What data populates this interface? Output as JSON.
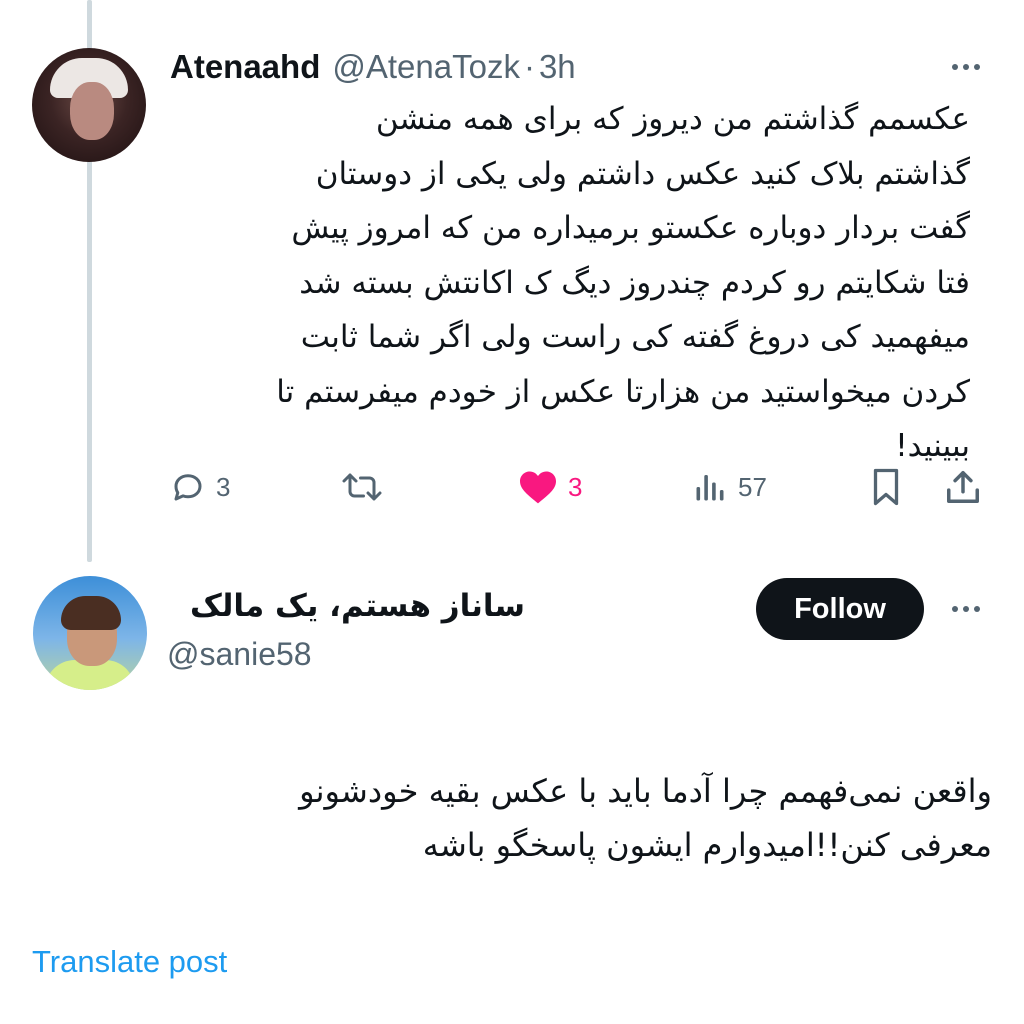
{
  "tweet1": {
    "display_name": "Atenaahd",
    "handle": "@AtenaTozk",
    "separator": "·",
    "time": "3h",
    "text_lines": [
      "عکسمم گذاشتم من دیروز که برای همه منشن",
      "گذاشتم بلاک کنید عکس داشتم ولی یکی از دوستان",
      "گفت بردار دوباره عکستو برمیداره من که امروز پیش",
      "فتا شکایتم رو کردم چندروز دیگ ک اکانتش بسته شد",
      "میفهمید کی دروغ گفته کی راست ولی اگر شما ثابت",
      "کردن میخواستید من هزارتا عکس از خودم میفرستم تا",
      "ببینید!"
    ],
    "actions": {
      "reply_count": "3",
      "repost_count": "",
      "like_count": "3",
      "views_count": "57"
    },
    "icons": {
      "reply": "reply-icon",
      "repost": "repost-icon",
      "like": "heart-icon",
      "views": "views-icon",
      "bookmark": "bookmark-icon",
      "share": "share-icon",
      "more": "more-icon"
    }
  },
  "tweet2": {
    "display_name": "ساناز هستم، یک مالک",
    "handle": "@sanie58",
    "follow_label": "Follow",
    "text_lines": [
      "واقعن نمی‌فهمم چرا آدما باید با عکس بقیه خودشونو",
      "معرفی کنن!!امیدوارم ایشون پاسخگو باشه"
    ],
    "translate_label": "Translate post"
  },
  "colors": {
    "text": "#0f1419",
    "secondary": "#536471",
    "like": "#f91880",
    "link": "#1d9bf0",
    "thread_line": "#cfd9de",
    "follow_bg": "#0f1419"
  }
}
